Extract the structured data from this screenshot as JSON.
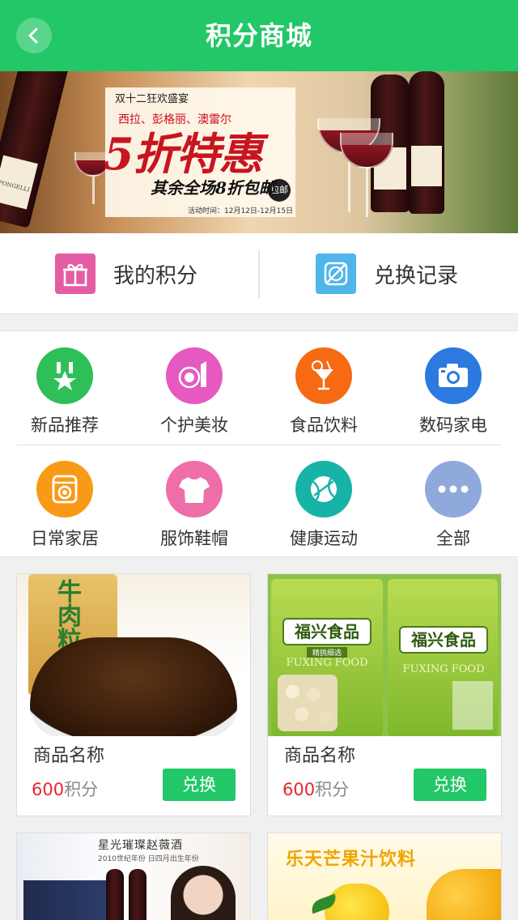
{
  "header": {
    "title": "积分商城",
    "back_icon": "chevron-left-icon"
  },
  "banner": {
    "line1": "双十二狂欢盛宴",
    "line2": "西拉、彭格丽、澳雷尔",
    "headline": "5折特惠",
    "sub": "其余全场8折包邮",
    "badge": "包邮",
    "date": "活动时间：12月12日-12月15日",
    "bottle_label": "PONGELLI"
  },
  "quick_links": [
    {
      "label": "我的积分",
      "icon": "gift-icon",
      "color": "#e45da4"
    },
    {
      "label": "兑换记录",
      "icon": "no-record-icon",
      "color": "#4fb5ea"
    }
  ],
  "categories": [
    {
      "label": "新品推荐",
      "icon": "medal-star-icon",
      "color": "#2ebf58"
    },
    {
      "label": "个护美妆",
      "icon": "compact-lipstick-icon",
      "color": "#e559c0"
    },
    {
      "label": "食品饮料",
      "icon": "cocktail-icon",
      "color": "#f56a12"
    },
    {
      "label": "数码家电",
      "icon": "camera-icon",
      "color": "#2c7ae0"
    },
    {
      "label": "日常家居",
      "icon": "washing-machine-icon",
      "color": "#f89a15"
    },
    {
      "label": "服饰鞋帽",
      "icon": "tshirt-icon",
      "color": "#ee6eaa"
    },
    {
      "label": "健康运动",
      "icon": "basketball-icon",
      "color": "#17b3a6"
    },
    {
      "label": "全部",
      "icon": "more-dots-icon",
      "color": "#8fa9dc"
    }
  ],
  "products": [
    {
      "name": "商品名称",
      "points": "600",
      "unit": "积分",
      "button": "兑换",
      "image_text": "牛肉粒"
    },
    {
      "name": "商品名称",
      "points": "600",
      "unit": "积分",
      "button": "兑换",
      "image_text": "福兴食品",
      "image_sub": "FUXING FOOD",
      "image_tag": "精挑细选"
    },
    {
      "image_text": "星光璀璨赵薇酒",
      "image_sub": "2010世纪年份 日四月出生年份"
    },
    {
      "image_text": "乐天芒果汁饮料"
    }
  ]
}
